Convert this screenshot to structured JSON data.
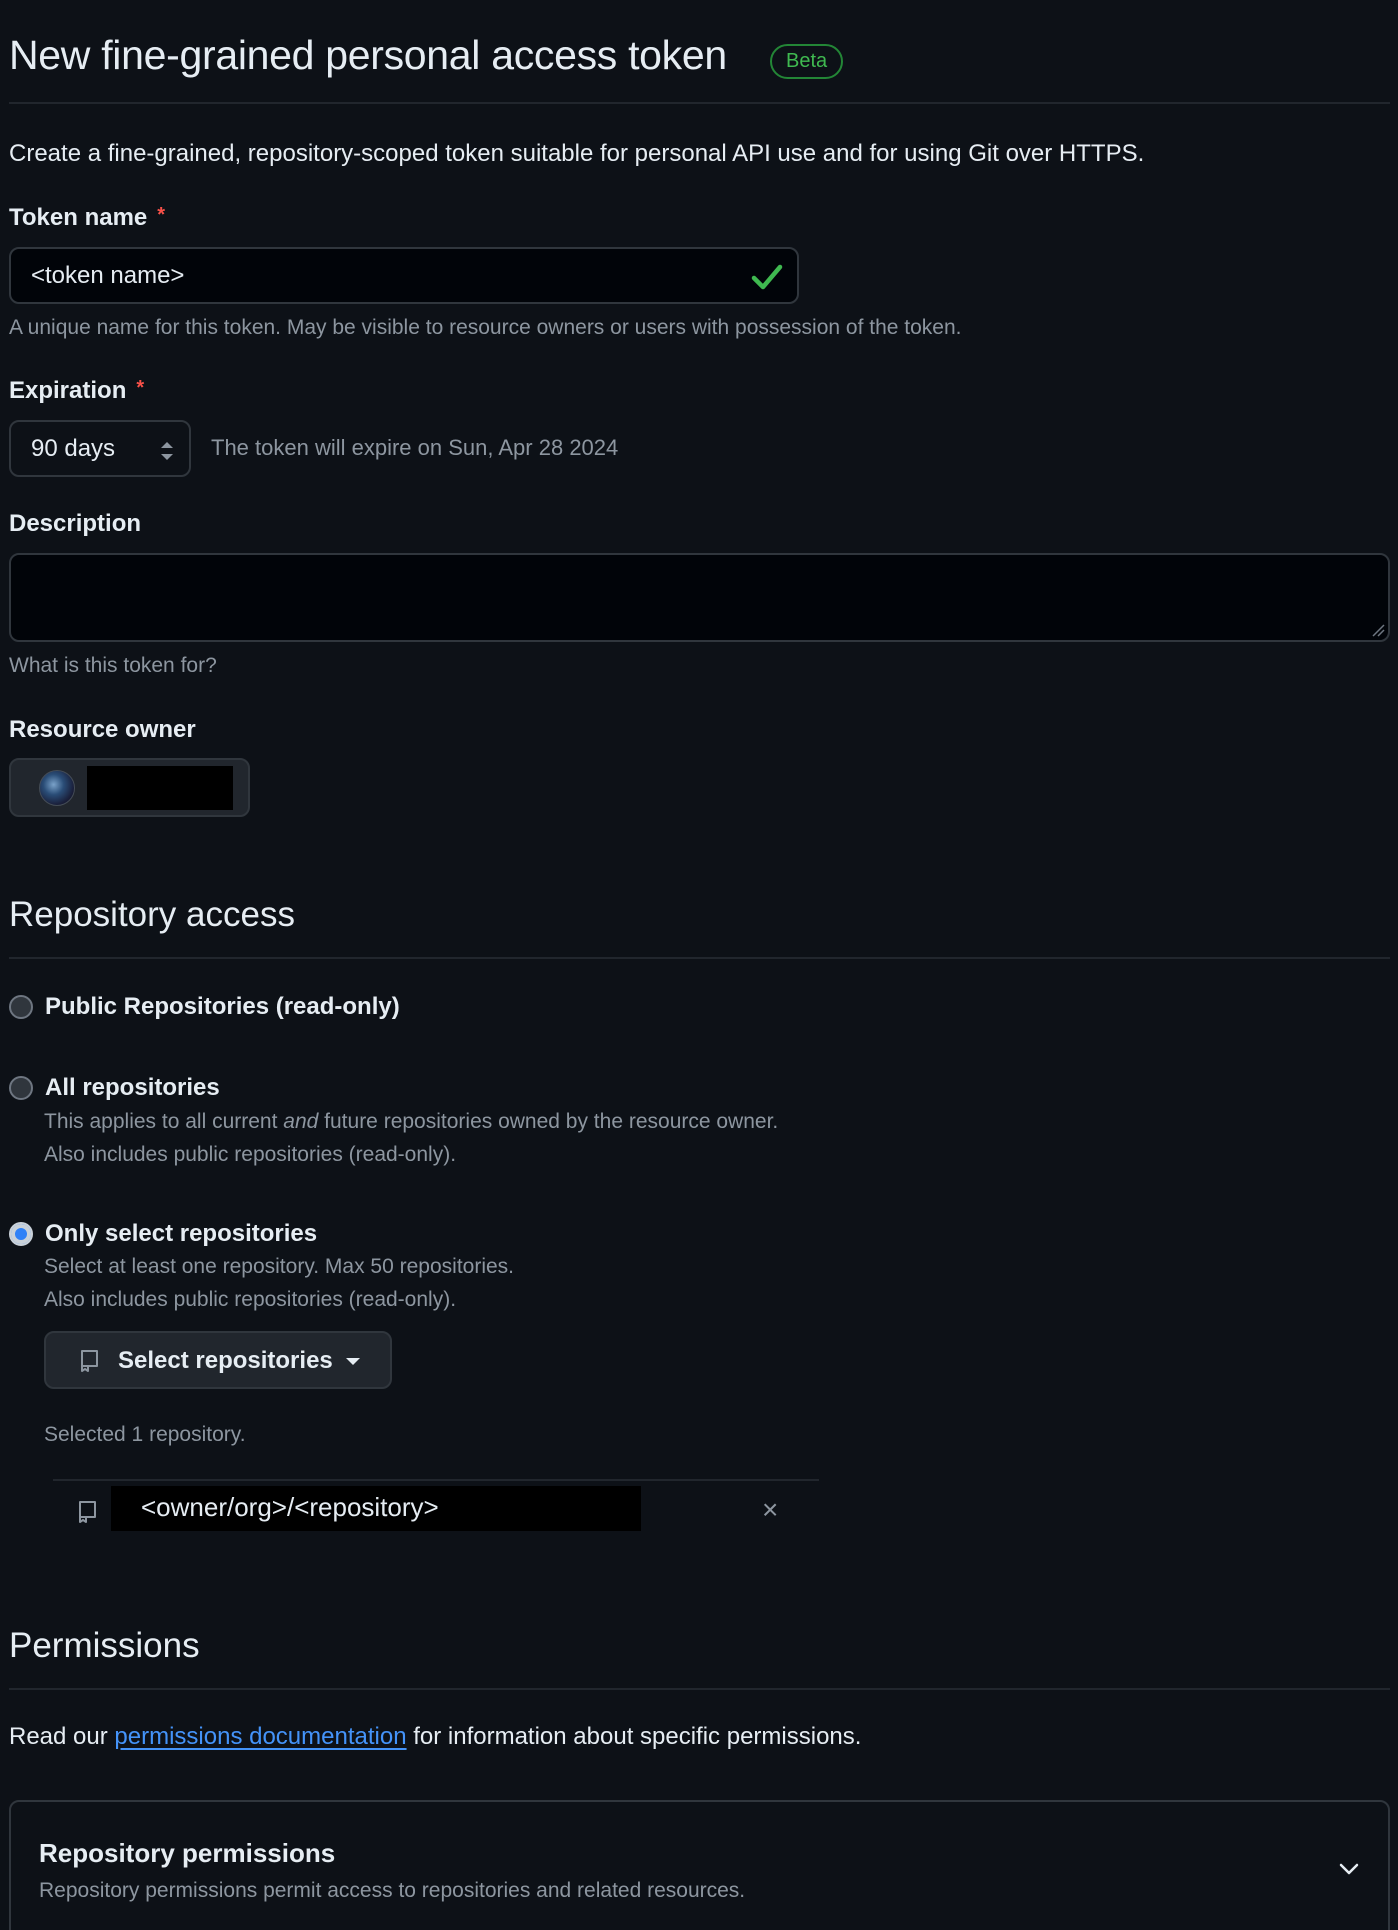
{
  "header": {
    "title": "New fine-grained personal access token",
    "badge": "Beta",
    "intro": "Create a fine-grained, repository-scoped token suitable for personal API use and for using Git over HTTPS."
  },
  "token_name": {
    "label": "Token name",
    "required_mark": "*",
    "value": "<token name>",
    "hint": "A unique name for this token. May be visible to resource owners or users with possession of the token."
  },
  "expiration": {
    "label": "Expiration",
    "required_mark": "*",
    "selected": "90 days",
    "note": "The token will expire on Sun, Apr 28 2024"
  },
  "description": {
    "label": "Description",
    "value": "",
    "hint": "What is this token for?"
  },
  "resource_owner": {
    "label": "Resource owner"
  },
  "repository_access": {
    "heading": "Repository access",
    "options": [
      {
        "label": "Public Repositories (read-only)",
        "checked": false
      },
      {
        "label": "All repositories",
        "checked": false,
        "desc_pre": "This applies to all current ",
        "desc_em": "and",
        "desc_post": " future repositories owned by the resource owner.",
        "desc_line2": "Also includes public repositories (read-only)."
      },
      {
        "label": "Only select repositories",
        "checked": true,
        "desc_line1": "Select at least one repository. Max 50 repositories.",
        "desc_line2": "Also includes public repositories (read-only)."
      }
    ],
    "select_button": "Select repositories",
    "selected_count": "Selected 1 repository.",
    "selected_repos": [
      "<owner/org>/<repository>"
    ],
    "remove_glyph": "×"
  },
  "permissions": {
    "heading": "Permissions",
    "intro_pre": "Read our ",
    "intro_link": "permissions documentation",
    "intro_post": " for information about specific permissions.",
    "repo_perms_title": "Repository permissions",
    "repo_perms_desc": "Repository permissions permit access to repositories and related resources."
  },
  "colors": {
    "background": "#0d1117",
    "accent_link": "#4493f8",
    "success": "#3fb950",
    "danger": "#f85149",
    "muted_text": "#8d96a0"
  },
  "icons": [
    "check-icon",
    "select-arrows-icon",
    "resize-grip-icon",
    "repo-icon",
    "caret-down-icon",
    "close-icon",
    "chevron-down-icon"
  ]
}
